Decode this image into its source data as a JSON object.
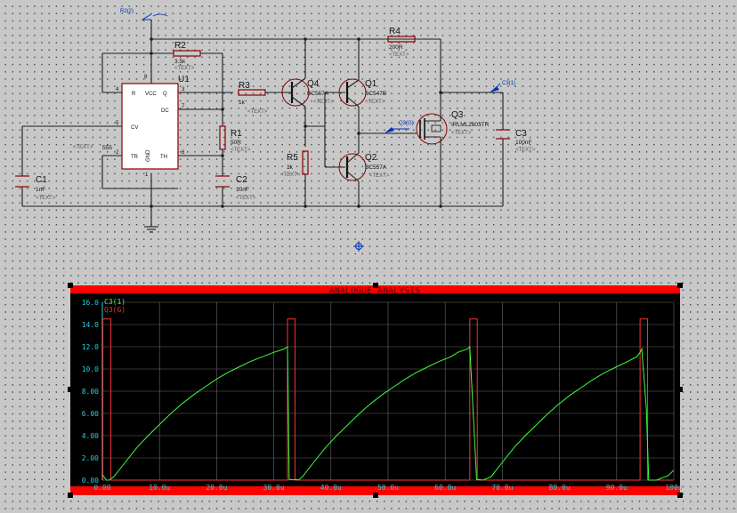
{
  "schematic": {
    "components": {
      "r2": {
        "ref": "R2",
        "value": "3.5k"
      },
      "r1": {
        "ref": "R1",
        "value": "50R"
      },
      "r3": {
        "ref": "R3",
        "value": "1k"
      },
      "r4": {
        "ref": "R4",
        "value": "200R"
      },
      "r5": {
        "ref": "R5",
        "value": "1k"
      },
      "c1": {
        "ref": "C1",
        "value": "1nF"
      },
      "c2": {
        "ref": "C2",
        "value": "10nF"
      },
      "c3": {
        "ref": "C3",
        "value": "100nF"
      },
      "u1": {
        "ref": "U1",
        "value": "555"
      },
      "q1": {
        "ref": "Q1",
        "value": "BC547B"
      },
      "q2": {
        "ref": "Q2",
        "value": "BC557A"
      },
      "q3": {
        "ref": "Q3",
        "value": "IRLML2803TR"
      },
      "q4": {
        "ref": "Q4",
        "value": "BC557A"
      }
    },
    "ic_pins": {
      "r": "R",
      "vcc": "VCC",
      "q": "Q",
      "dc": "DC",
      "cv": "CV",
      "tr": "TR",
      "gnd": "GND",
      "th": "TH",
      "p4": "4",
      "p8": "8",
      "p3": "3",
      "p7": "7",
      "p5": "5",
      "p2": "2",
      "p1": "1",
      "p6": "6"
    },
    "text_placeholder": "<TEXT>",
    "probes": {
      "supply": "R2(2)",
      "gate": "Q3(G)",
      "output": "C3(1)"
    }
  },
  "graph": {
    "title": "ANALOGUE ANALYSIS",
    "legend": [
      {
        "name": "C3(1)",
        "color": "#3cff3c"
      },
      {
        "name": "Q3(G)",
        "color": "#ff3030"
      }
    ]
  },
  "chart_data": {
    "type": "line",
    "title": "ANALOGUE ANALYSIS",
    "xlabel": "",
    "ylabel": "",
    "xlim": [
      0,
      100
    ],
    "ylim": [
      0,
      16
    ],
    "x_ticks": [
      "0.00",
      "10.0u",
      "20.0u",
      "30.0u",
      "40.0u",
      "50.0u",
      "60.0u",
      "70.0u",
      "80.0u",
      "90.0u",
      "100u"
    ],
    "y_ticks": [
      "0.00",
      "2.00",
      "4.00",
      "6.00",
      "8.00",
      "10.0",
      "12.0",
      "14.0",
      "16.0"
    ],
    "grid": true,
    "legend_position": "top-left",
    "series": [
      {
        "name": "C3(1)",
        "color": "#3cff3c",
        "x": [
          0.0,
          0.7,
          1.2,
          2,
          4,
          6,
          8,
          10,
          12,
          14,
          16,
          18,
          20,
          22,
          24,
          26,
          28,
          30,
          31.8,
          32.4,
          32.7,
          34,
          34.3,
          35,
          37,
          39,
          41,
          43,
          45,
          47,
          49,
          51,
          53,
          55,
          57,
          59,
          61,
          62.2,
          63.9,
          64.3,
          65.5,
          65.9,
          66.6,
          68,
          70,
          72,
          74,
          76,
          78,
          80,
          82,
          84,
          86,
          88,
          90,
          92,
          93.5,
          94.1,
          94.4,
          95.2,
          95.6,
          97,
          99,
          100
        ],
        "y": [
          0.5,
          0.0,
          0.0,
          0.3,
          1.6,
          2.9,
          4.0,
          5.0,
          6.0,
          6.9,
          7.7,
          8.4,
          9.1,
          9.7,
          10.2,
          10.7,
          11.1,
          11.5,
          11.8,
          12.0,
          0.05,
          0.05,
          0.0,
          0.3,
          1.6,
          2.9,
          4.0,
          5.0,
          6.0,
          6.9,
          7.7,
          8.4,
          9.1,
          9.7,
          10.2,
          10.7,
          11.1,
          11.5,
          11.8,
          12.0,
          0.05,
          0.05,
          0.0,
          0.3,
          1.6,
          2.9,
          4.0,
          5.0,
          6.0,
          6.9,
          7.7,
          8.4,
          9.1,
          9.7,
          10.2,
          10.7,
          11.1,
          11.5,
          11.8,
          6.4,
          0.0,
          0.0,
          0.4,
          0.9
        ]
      },
      {
        "name": "Q3(G)",
        "color": "#ff3030",
        "x": [
          0,
          0.1,
          0.1,
          1.5,
          1.5,
          32.4,
          32.4,
          33.7,
          33.7,
          64.3,
          64.3,
          65.6,
          65.6,
          94.1,
          94.1,
          95.4,
          95.4,
          100
        ],
        "y": [
          0,
          0,
          14.5,
          14.5,
          0,
          0,
          14.5,
          14.5,
          0,
          0,
          14.5,
          14.5,
          0,
          0,
          14.5,
          14.5,
          0,
          0
        ]
      }
    ]
  }
}
